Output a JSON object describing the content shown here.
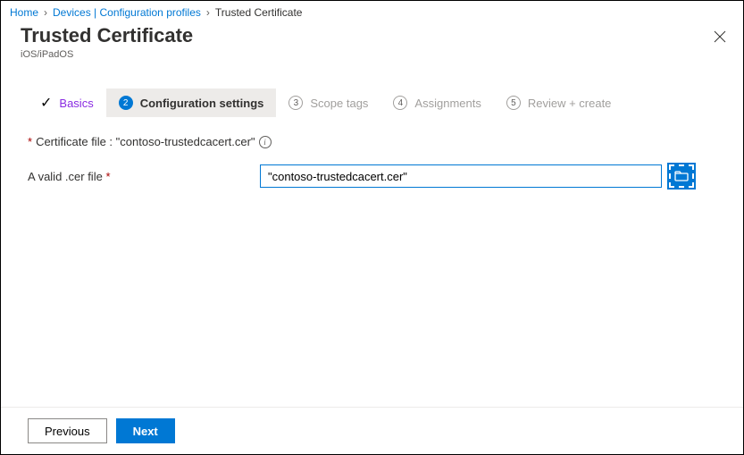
{
  "breadcrumb": {
    "home": "Home",
    "devices": "Devices | Configuration profiles",
    "current": "Trusted Certificate"
  },
  "header": {
    "title": "Trusted Certificate",
    "subtitle": "iOS/iPadOS"
  },
  "wizard": {
    "steps": [
      {
        "num": "",
        "label": "Basics"
      },
      {
        "num": "2",
        "label": "Configuration settings"
      },
      {
        "num": "3",
        "label": "Scope tags"
      },
      {
        "num": "4",
        "label": "Assignments"
      },
      {
        "num": "5",
        "label": "Review + create"
      }
    ]
  },
  "form": {
    "certFileLabel": "Certificate file : \"contoso-trustedcacert.cer\"",
    "validCerLabel": "A valid .cer file",
    "certInputValue": "\"contoso-trustedcacert.cer\""
  },
  "footer": {
    "previous": "Previous",
    "next": "Next"
  }
}
